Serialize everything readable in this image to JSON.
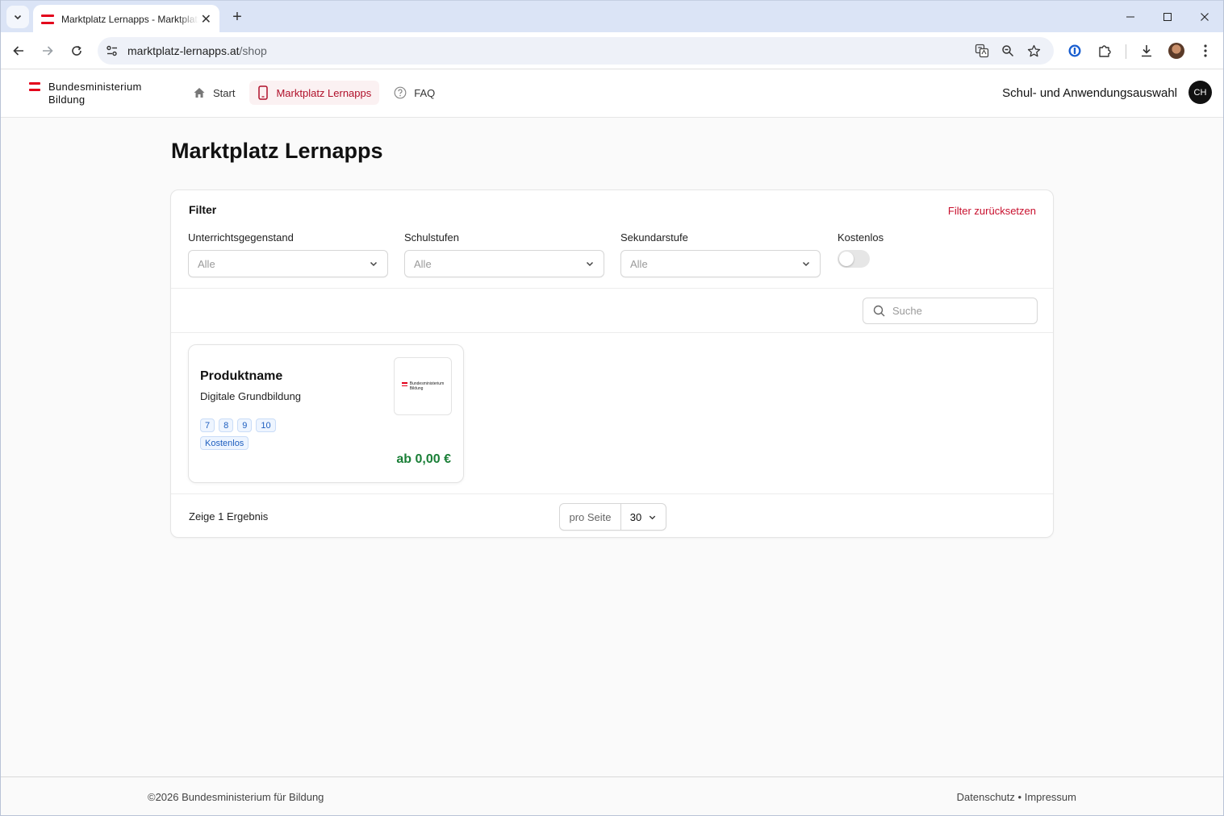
{
  "browser": {
    "tab_title": "Marktplatz Lernapps - Marktplatz Lernapps",
    "url_host": "marktplatz-lernapps.at",
    "url_path": "/shop"
  },
  "header": {
    "brand_line1": "Bundesministerium",
    "brand_line2": "Bildung",
    "nav": [
      {
        "label": "Start",
        "icon": "home-icon"
      },
      {
        "label": "Marktplatz Lernapps",
        "icon": "phone-icon",
        "active": true
      },
      {
        "label": "FAQ",
        "icon": "help-circle-icon"
      }
    ],
    "school_selector": "Schul- und Anwendungsauswahl",
    "user_initials": "CH"
  },
  "page": {
    "title": "Marktplatz Lernapps"
  },
  "filter": {
    "heading": "Filter",
    "reset_label": "Filter zurücksetzen",
    "fields": [
      {
        "label": "Unterrichtsgegenstand",
        "value": "Alle"
      },
      {
        "label": "Schulstufen",
        "value": "Alle"
      },
      {
        "label": "Sekundarstufe",
        "value": "Alle"
      }
    ],
    "free_label": "Kostenlos",
    "free_enabled": false
  },
  "search": {
    "placeholder": "Suche"
  },
  "products": [
    {
      "name": "Produktname",
      "category": "Digitale Grundbildung",
      "thumb_line1": "Bundesministerium",
      "thumb_line2": "Bildung",
      "grades": [
        "7",
        "8",
        "9",
        "10"
      ],
      "free_badge": "Kostenlos",
      "price": "ab 0,00 €"
    }
  ],
  "results": {
    "count_text": "Zeige 1 Ergebnis",
    "per_page_label": "pro Seite",
    "per_page_value": "30"
  },
  "footer": {
    "copyright": "©2026 Bundesministerium für Bildung",
    "privacy": "Datenschutz",
    "separator": "•",
    "imprint": "Impressum"
  },
  "colors": {
    "brand_red": "#e3001b",
    "active_nav": "#b0102a",
    "price_green": "#1a7f37",
    "badge_blue": "#1f5fbf"
  }
}
